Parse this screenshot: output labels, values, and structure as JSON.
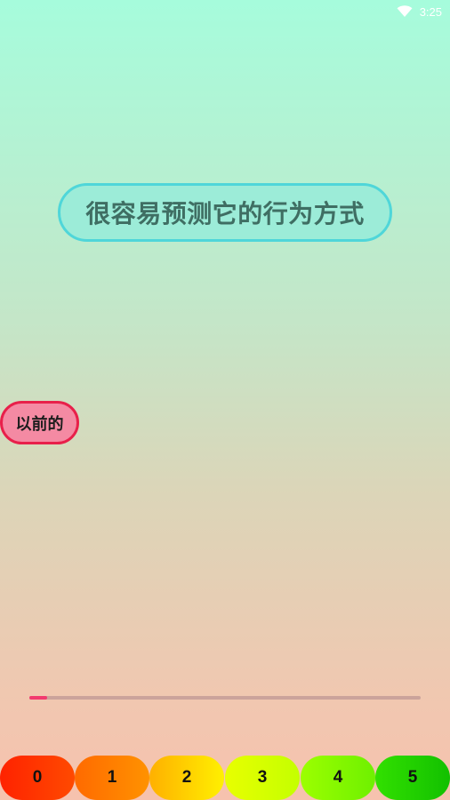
{
  "status_bar": {
    "time": "3:25",
    "wifi_icon": "wifi-icon"
  },
  "card": {
    "question_text": "很容易预测它的行为方式",
    "answer_label": "以前的"
  },
  "progress": {
    "fraction": 0.045,
    "color": "#f23b6f"
  },
  "rating_buttons": [
    {
      "label": "0",
      "color_from": "#ff2200",
      "color_to": "#ff4a00"
    },
    {
      "label": "1",
      "color_from": "#ff6a00",
      "color_to": "#ff9200"
    },
    {
      "label": "2",
      "color_from": "#ffb000",
      "color_to": "#fff000"
    },
    {
      "label": "3",
      "color_from": "#e8ff00",
      "color_to": "#c4ff00"
    },
    {
      "label": "4",
      "color_from": "#9cff00",
      "color_to": "#6ef000"
    },
    {
      "label": "5",
      "color_from": "#32e000",
      "color_to": "#12c000"
    }
  ]
}
